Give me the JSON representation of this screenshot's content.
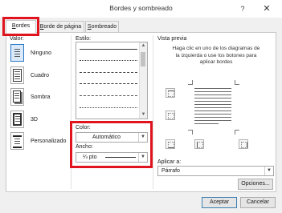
{
  "window": {
    "title": "Bordes y sombreado",
    "help": "?",
    "close": "✕"
  },
  "tabs": [
    {
      "label": "Bordes",
      "underline": "B",
      "rest": "ordes",
      "active": true
    },
    {
      "label": "Borde de página",
      "underline": "B",
      "rest": "orde de página",
      "active": false
    },
    {
      "label": "Sombreado",
      "underline": "S",
      "rest": "ombreado",
      "active": false
    }
  ],
  "settings": {
    "header": "Valor:",
    "items": [
      {
        "label": "Ninguno",
        "selected": true
      },
      {
        "label": "Cuadro",
        "selected": false
      },
      {
        "label": "Sombra",
        "selected": false
      },
      {
        "label": "3D",
        "selected": false
      },
      {
        "label": "Personalizado",
        "selected": false
      }
    ]
  },
  "style": {
    "header": "Estilo:",
    "lines": [
      "solid",
      "dotted",
      "dashed-small",
      "dashed",
      "dash-dot",
      "dash-dot-dot"
    ]
  },
  "color": {
    "label": "Color:",
    "value": "Automático"
  },
  "width": {
    "label": "Ancho:",
    "value": "¼ pto"
  },
  "preview": {
    "header": "Vista previa",
    "instructions": "Haga clic en uno de los diagramas de la izquierda o use los botones para aplicar bordes"
  },
  "apply_to": {
    "label": "Aplicar a:",
    "value": "Párrafo"
  },
  "buttons": {
    "options": "Opciones...",
    "accept": "Aceptar",
    "cancel": "Cancelar"
  },
  "colors": {
    "highlight": "#e0141e",
    "selected_border": "#2b78c6"
  }
}
